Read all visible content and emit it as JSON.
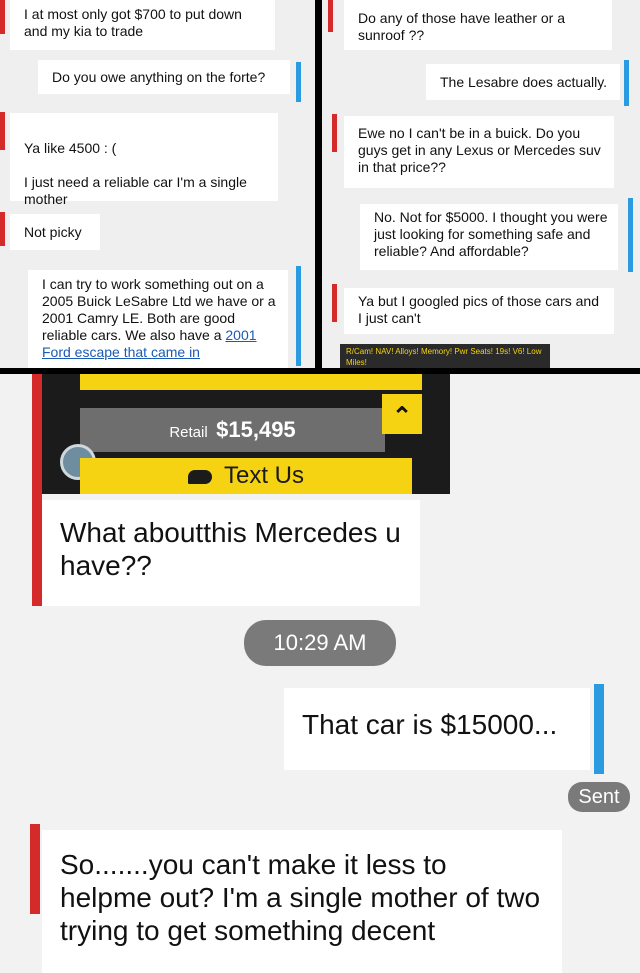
{
  "left_panel": {
    "messages": [
      {
        "dir": "in",
        "text": "I at most only got $700 to put down and my kia to trade"
      },
      {
        "dir": "out",
        "text": "Do you owe anything on the forte?"
      },
      {
        "dir": "in",
        "text": "Ya like 4500 : (\n\nI just need a reliable car I'm a single mother"
      },
      {
        "dir": "in",
        "text": "Not picky"
      },
      {
        "dir": "out",
        "text": "I can try to work something out on a 2005 Buick LeSabre Ltd we have or a 2001 Camry LE. Both are good reliable cars. We also have a ",
        "link": "2001 Ford escape that came in"
      }
    ]
  },
  "right_panel": {
    "messages": [
      {
        "dir": "in",
        "text": "Do any of those have leather or a sunroof ??"
      },
      {
        "dir": "out",
        "text": "The Lesabre does actually."
      },
      {
        "dir": "in",
        "text": "Ewe no I can't be in a buick. Do you guys get in any Lexus or Mercedes suv in that price??"
      },
      {
        "dir": "out",
        "text": "No. Not for $5000. I thought you were just looking for something safe and reliable? And affordable?"
      },
      {
        "dir": "in",
        "text": "Ya but I googled pics of those cars and I just can't"
      }
    ],
    "ad_strip": "R/Cam! NAV! Alloys! Memory! Pwr Seats! 19s! V6! Low Miles!"
  },
  "bottom_panel": {
    "listing": {
      "retail_label": "Retail",
      "retail_price": "$15,495",
      "text_us_label": "Text Us",
      "collapse_icon": "chevron-up-icon"
    },
    "messages": [
      {
        "dir": "in",
        "text": "What aboutthis Mercedes u have??"
      },
      {
        "dir": "out",
        "text": "That car is $15000..."
      },
      {
        "dir": "in",
        "text": "So.......you can't make it less to helpme out? I'm a single mother of two trying to get something decent"
      }
    ],
    "timestamp": "10:29 AM",
    "sent_label": "Sent"
  },
  "colors": {
    "incoming_flag": "#d42a2a",
    "outgoing_flag": "#2a9be0",
    "listing_yellow": "#f5d312"
  }
}
